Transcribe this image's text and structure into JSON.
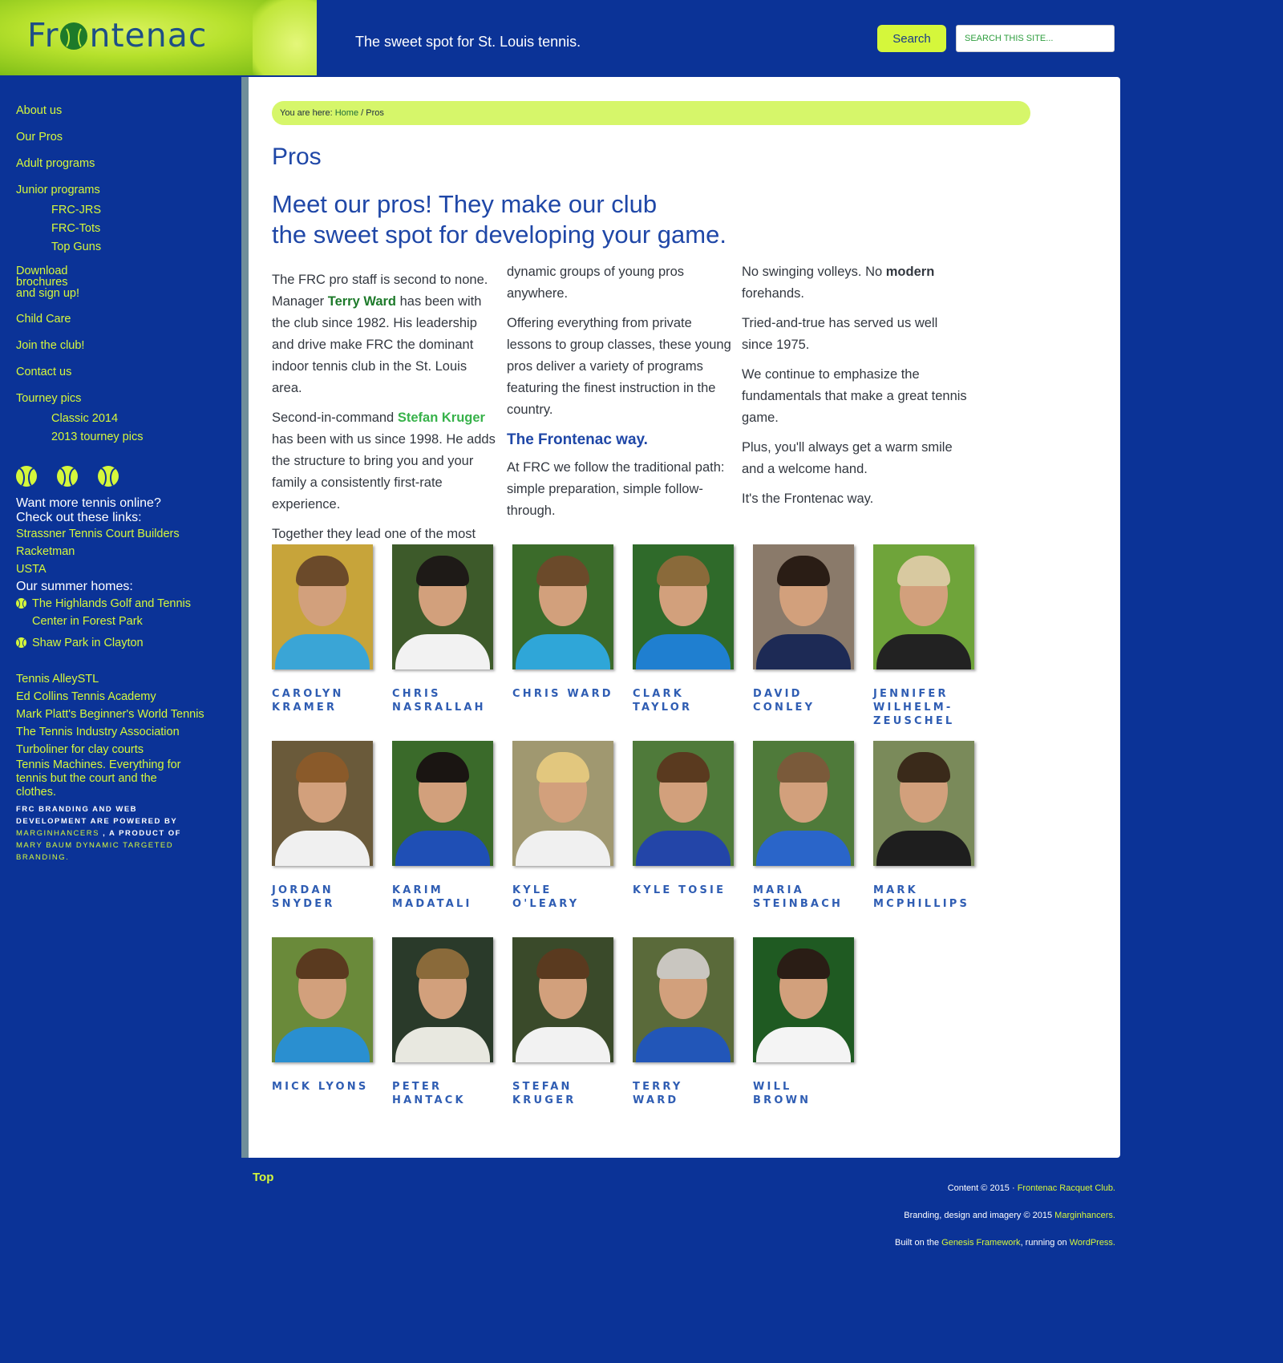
{
  "header": {
    "logo_prefix": "Fr",
    "logo_suffix": "ntenac",
    "tagline": "The sweet spot for St. Louis tennis.",
    "search_label": "Search",
    "search_placeholder": "SEARCH THIS SITE..."
  },
  "sidebar": {
    "nav": [
      {
        "label": "About us"
      },
      {
        "label": "Our Pros"
      },
      {
        "label": "Adult programs"
      },
      {
        "label": "Junior programs",
        "children": [
          "FRC-JRS",
          "FRC-Tots",
          "Top Guns"
        ]
      },
      {
        "label": "Download brochures and sign up!"
      },
      {
        "label": "Child Care"
      },
      {
        "label": "Join the club!"
      },
      {
        "label": "Contact us"
      },
      {
        "label": "Tourney pics",
        "children": [
          "Classic 2014",
          "2013 tourney pics"
        ]
      }
    ],
    "more_heading": "Want more tennis online? Check out these links:",
    "more_links": [
      "Strassner Tennis Court Builders",
      "Racketman",
      "USTA"
    ],
    "summer_heading": "Our summer homes:",
    "summer_links": [
      "The Highlands Golf and Tennis Center in Forest Park",
      "Shaw Park in Clayton"
    ],
    "other_links": [
      "Tennis AlleySTL",
      "Ed Collins Tennis Academy",
      "Mark Platt's Beginner's World Tennis",
      "The Tennis Industry Association",
      "Turboliner for clay courts",
      "Tennis Machines. Everything for tennis but the court and the clothes."
    ],
    "powered_part1": "FRC branding and web development are powered by",
    "powered_link": "Marginhancers",
    "powered_part2": ", a product of",
    "powered_part3": "Mary Baum Dynamic Targeted Branding."
  },
  "breadcrumb": {
    "prefix": "You are here:",
    "home": "Home",
    "separator": "/",
    "current": "Pros"
  },
  "page_title": "Pros",
  "headline_line1": "Meet our pros! They make our club",
  "headline_line2": "the sweet spot for developing your game.",
  "content": {
    "p1_a": "The FRC pro staff is second to none. Manager",
    "p1_name": "Terry Ward",
    "p1_b": "has been with the club since 1982. His leadership and drive make FRC the dominant indoor tennis club in the St. Louis area.",
    "p2_a": "Second-in-command",
    "p2_name": "Stefan Kruger",
    "p2_b": "has been with us since 1998. He adds the structure to bring you and your family a consistently first-rate experience.",
    "p3": "Together they lead one of the most",
    "p4": "dynamic groups of young pros anywhere.",
    "p5": "Offering everything from private lessons to group classes, these young pros deliver a variety of programs featuring the finest instruction in the country.",
    "way_heading": "The Frontenac way.",
    "p6": "At FRC we follow the traditional path: simple preparation, simple follow-through.",
    "p7_a": "No swinging volleys. No",
    "p7_bold": "modern",
    "p7_b": "forehands.",
    "p8": "Tried-and-true has served us well since 1975.",
    "p9": "We continue to emphasize the fundamentals that make a great tennis game.",
    "p10": "Plus, you'll always get a warm smile and a welcome hand.",
    "p11": "It's the Frontenac way."
  },
  "pros": [
    {
      "name": "Carolyn Kramer",
      "bg": "#c7a43a",
      "shirt": "#3aa5d6",
      "hair": "#6b4a2a"
    },
    {
      "name": "Chris Nasrallah",
      "bg": "#3d5a2a",
      "shirt": "#f2f2f2",
      "hair": "#1e1a17"
    },
    {
      "name": "Chris Ward",
      "bg": "#3b6b2a",
      "shirt": "#2fa6d8",
      "hair": "#6b4a2a"
    },
    {
      "name": "Clark Taylor",
      "bg": "#2f6a2a",
      "shirt": "#1f7fd0",
      "hair": "#8a6a3a"
    },
    {
      "name": "David Conley",
      "bg": "#8a7a6a",
      "shirt": "#1d2a55",
      "hair": "#2a1d15"
    },
    {
      "name": "Jennifer Wilhelm-Zeuschel",
      "bg": "#6fa43a",
      "shirt": "#222222",
      "hair": "#d8c9a0"
    },
    {
      "name": "Jordan Snyder",
      "bg": "#6a5a3a",
      "shirt": "#f0f0f0",
      "hair": "#8a5a2a"
    },
    {
      "name": "Karim Madatali",
      "bg": "#3a6a2a",
      "shirt": "#1f4fb5",
      "hair": "#1a1512"
    },
    {
      "name": "Kyle O'Leary",
      "bg": "#a09870",
      "shirt": "#f0f0f0",
      "hair": "#e2c77e"
    },
    {
      "name": "Kyle Tosie",
      "bg": "#4f7a3a",
      "shirt": "#2345a8",
      "hair": "#5a3a1f"
    },
    {
      "name": "Maria Steinbach",
      "bg": "#4f7a3a",
      "shirt": "#2a65c9",
      "hair": "#7a5a3a"
    },
    {
      "name": "Mark McPhillips",
      "bg": "#7a8a5a",
      "shirt": "#1e1e1e",
      "hair": "#3a2a1a"
    },
    {
      "name": "Mick Lyons",
      "bg": "#6a8a3a",
      "shirt": "#2a8fd0",
      "hair": "#5a3a1f"
    },
    {
      "name": "Peter Hantack",
      "bg": "#2a3a2a",
      "shirt": "#e8e8e0",
      "hair": "#8a6a3a"
    },
    {
      "name": "Stefan Kruger",
      "bg": "#3a4a2a",
      "shirt": "#f2f2f2",
      "hair": "#5a3a1f"
    },
    {
      "name": "Terry Ward",
      "bg": "#5a6a3a",
      "shirt": "#2256b8",
      "hair": "#c9c6c0"
    },
    {
      "name": "Will Brown",
      "bg": "#1f5a22",
      "shirt": "#f4f4f4",
      "hair": "#2a1d15"
    }
  ],
  "footer": {
    "top_label": "Top",
    "line1_prefix": "Content © 2015 ·",
    "line1_link": "Frontenac Racquet Club.",
    "line2_prefix": "Branding, design and imagery © 2015",
    "line2_link": "Marginhancers.",
    "line3_prefix": "Built on the",
    "line3_link1": "Genesis Framework",
    "line3_mid": ", running on",
    "line3_link2": "WordPress."
  }
}
